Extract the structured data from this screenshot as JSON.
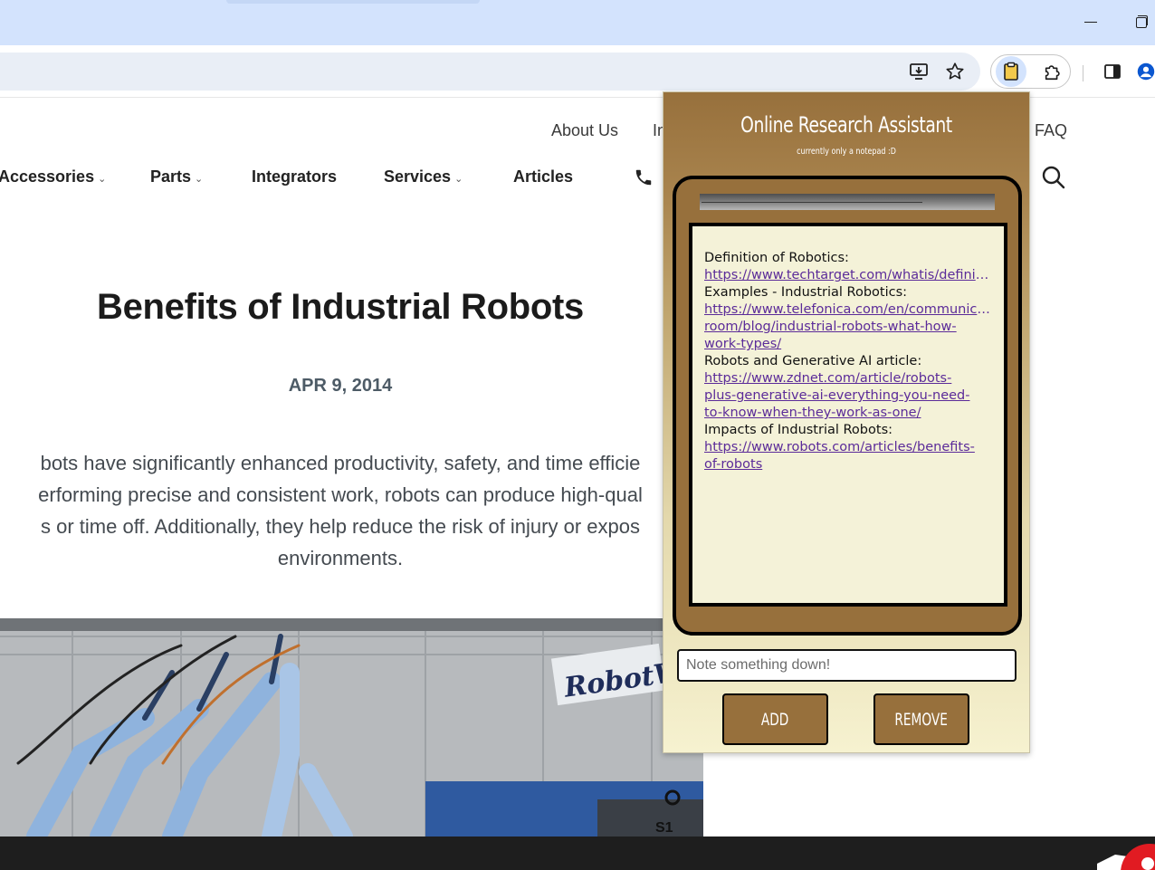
{
  "browser": {
    "icons": {
      "install": "install-app-icon",
      "bookmark": "star-icon",
      "extension_active": "clipboard-icon",
      "extensions": "puzzle-icon",
      "side_panel": "side-panel-icon",
      "profile": "profile-icon",
      "minimize": "minimize-icon",
      "restore": "restore-icon"
    }
  },
  "site": {
    "top_nav": {
      "about": "About Us",
      "partial": "In",
      "faq": "FAQ"
    },
    "main_nav": {
      "accessories": "Accessories",
      "parts": "Parts",
      "integrators": "Integrators",
      "services": "Services",
      "articles": "Articles",
      "phone_partial": "("
    },
    "article": {
      "title": "Benefits of Industrial Robots",
      "date": "APR 9, 2014",
      "body_lines": [
        "bots have significantly enhanced productivity, safety, and time efficie",
        "erforming precise and consistent work, robots can produce high-qual",
        "s or time off. Additionally, they help reduce the risk of injury or expos",
        "environments."
      ],
      "hero_sign": "RobotWor"
    }
  },
  "popup": {
    "title": "Online Research Assistant",
    "subtitle": "currently only a notepad :D",
    "notes": [
      {
        "label": "Definition of Robotics:",
        "link_lines": [
          "https://www.techtarget.com/whatis/definition/robotics"
        ]
      },
      {
        "label": "Examples - Industrial Robotics:",
        "link_lines": [
          "https://www.telefonica.com/en/communication-",
          "room/blog/industrial-robots-what-how-",
          "work-types/"
        ]
      },
      {
        "label": "Robots and Generative AI article:",
        "link_lines": [
          "https://www.zdnet.com/article/robots-",
          "plus-generative-ai-everything-you-need-",
          "to-know-when-they-work-as-one/"
        ]
      },
      {
        "label": "Impacts of Industrial Robots:",
        "link_lines": [
          "https://www.robots.com/articles/benefits-",
          "of-robots"
        ]
      }
    ],
    "input_placeholder": "Note something down!",
    "add_label": "ADD",
    "remove_label": "REMOVE"
  }
}
